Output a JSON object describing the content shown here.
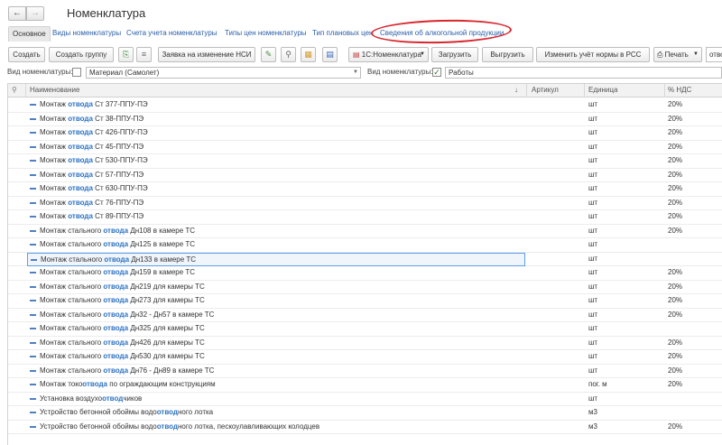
{
  "window": {
    "title": "Номенклатура",
    "nav_back": "←",
    "nav_forward": "→"
  },
  "tabs": [
    {
      "label": "Основное"
    },
    {
      "label": "Виды номенклатуры"
    },
    {
      "label": "Счета учета номенклатуры"
    },
    {
      "label": "Типы цен номенклатуры"
    },
    {
      "label": "Тип плановых цен"
    },
    {
      "label": "Сведения об алкогольной продукции"
    }
  ],
  "toolbar": {
    "create": "Создать",
    "create_group": "Создать группу",
    "request_nsi": "Заявка на изменение НСИ",
    "dropdown_1c": "1С:Номенклатура",
    "load": "Загрузить",
    "unload": "Выгрузить",
    "change_rss": "Изменить учёт нормы в РСС",
    "print": "Печать",
    "search_value": "отво"
  },
  "filters": {
    "kind_label": "Вид номенклатуры:",
    "kind_value": "Материал (Самолет)",
    "kind2_label": "Вид номенклатуры:",
    "kind2_value": "Работы",
    "kind2_check": "✓"
  },
  "table": {
    "headers": {
      "name": "Наименование",
      "article": "Артикул",
      "unit": "Единица",
      "vat": "% НДС",
      "sort": "↓"
    },
    "highlight_color": "#2b72c2",
    "selection_color": "#5c9ee8",
    "rows": [
      {
        "pre": "Монтаж ",
        "hl": "отвода",
        "post": " Ст 377-ППУ-ПЭ",
        "unit": "шт",
        "vat": "20%"
      },
      {
        "pre": "Монтаж ",
        "hl": "отвода",
        "post": " Ст 38-ППУ-ПЭ",
        "unit": "шт",
        "vat": "20%"
      },
      {
        "pre": "Монтаж ",
        "hl": "отвода",
        "post": " Ст 426-ППУ-ПЭ",
        "unit": "шт",
        "vat": "20%"
      },
      {
        "pre": "Монтаж ",
        "hl": "отвода",
        "post": " Ст 45-ППУ-ПЭ",
        "unit": "шт",
        "vat": "20%"
      },
      {
        "pre": "Монтаж ",
        "hl": "отвода",
        "post": " Ст 530-ППУ-ПЭ",
        "unit": "шт",
        "vat": "20%"
      },
      {
        "pre": "Монтаж ",
        "hl": "отвода",
        "post": " Ст 57-ППУ-ПЭ",
        "unit": "шт",
        "vat": "20%"
      },
      {
        "pre": "Монтаж ",
        "hl": "отвода",
        "post": " Ст 630-ППУ-ПЭ",
        "unit": "шт",
        "vat": "20%"
      },
      {
        "pre": "Монтаж ",
        "hl": "отвода",
        "post": " Ст 76-ППУ-ПЭ",
        "unit": "шт",
        "vat": "20%"
      },
      {
        "pre": "Монтаж ",
        "hl": "отвода",
        "post": " Ст 89-ППУ-ПЭ",
        "unit": "шт",
        "vat": "20%"
      },
      {
        "pre": "Монтаж стального ",
        "hl": "отвода",
        "post": " Дн108 в камере ТС",
        "unit": "шт",
        "vat": "20%"
      },
      {
        "pre": "Монтаж стального ",
        "hl": "отвода",
        "post": " Дн125 в камере ТС",
        "unit": "шт",
        "vat": ""
      },
      {
        "pre": "Монтаж стального ",
        "hl": "отвода",
        "post": " Дн133 в камере ТС",
        "unit": "шт",
        "vat": "",
        "selected": true
      },
      {
        "pre": "Монтаж стального ",
        "hl": "отвода",
        "post": " Дн159 в камере ТС",
        "unit": "шт",
        "vat": "20%"
      },
      {
        "pre": "Монтаж стального ",
        "hl": "отвода",
        "post": " Дн219 для камеры ТС",
        "unit": "шт",
        "vat": "20%"
      },
      {
        "pre": "Монтаж стального ",
        "hl": "отвода",
        "post": " Дн273 для камеры ТС",
        "unit": "шт",
        "vat": "20%"
      },
      {
        "pre": "Монтаж стального ",
        "hl": "отвода",
        "post": " Дн32 - Дн57 в камере ТС",
        "unit": "шт",
        "vat": "20%"
      },
      {
        "pre": "Монтаж стального ",
        "hl": "отвода",
        "post": " Дн325 для камеры ТС",
        "unit": "шт",
        "vat": ""
      },
      {
        "pre": "Монтаж стального ",
        "hl": "отвода",
        "post": " Дн426 для камеры ТС",
        "unit": "шт",
        "vat": "20%"
      },
      {
        "pre": "Монтаж стального ",
        "hl": "отвода",
        "post": " Дн530 для камеры ТС",
        "unit": "шт",
        "vat": "20%"
      },
      {
        "pre": "Монтаж стального ",
        "hl": "отвода",
        "post": " Дн76 - Дн89 в камере ТС",
        "unit": "шт",
        "vat": "20%"
      },
      {
        "pre": "Монтаж токо",
        "hl": "отвода",
        "post": " по ограждающим конструкциям",
        "unit": "пог. м",
        "vat": "20%"
      },
      {
        "pre": "Установка воздухо",
        "hl": "отвод",
        "post": "чиков",
        "unit": "шт",
        "vat": ""
      },
      {
        "pre": "Устройство бетонной обоймы водо",
        "hl": "отвод",
        "post": "ного лотка",
        "unit": "м3",
        "vat": ""
      },
      {
        "pre": "Устройство бетонной обоймы водо",
        "hl": "отвод",
        "post": "ного лотка, пескоулавливающих колодцев",
        "unit": "м3",
        "vat": "20%"
      }
    ]
  }
}
